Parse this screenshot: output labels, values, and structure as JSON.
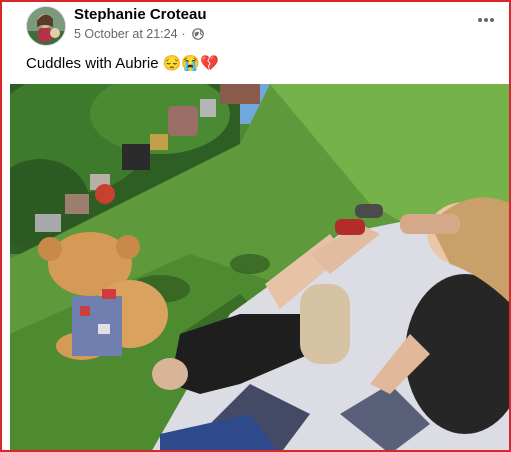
{
  "post": {
    "author_name": "Stephanie Croteau",
    "timestamp": "5 October at 21:24",
    "separator": "·",
    "audience_icon": "globe-icon",
    "caption": "Cuddles with Aubrie 😔😭💔",
    "more_icon": "more-options-icon"
  },
  "colors": {
    "frame_border": "#d9262a",
    "name_text": "#050505",
    "meta_text": "#65676b"
  }
}
